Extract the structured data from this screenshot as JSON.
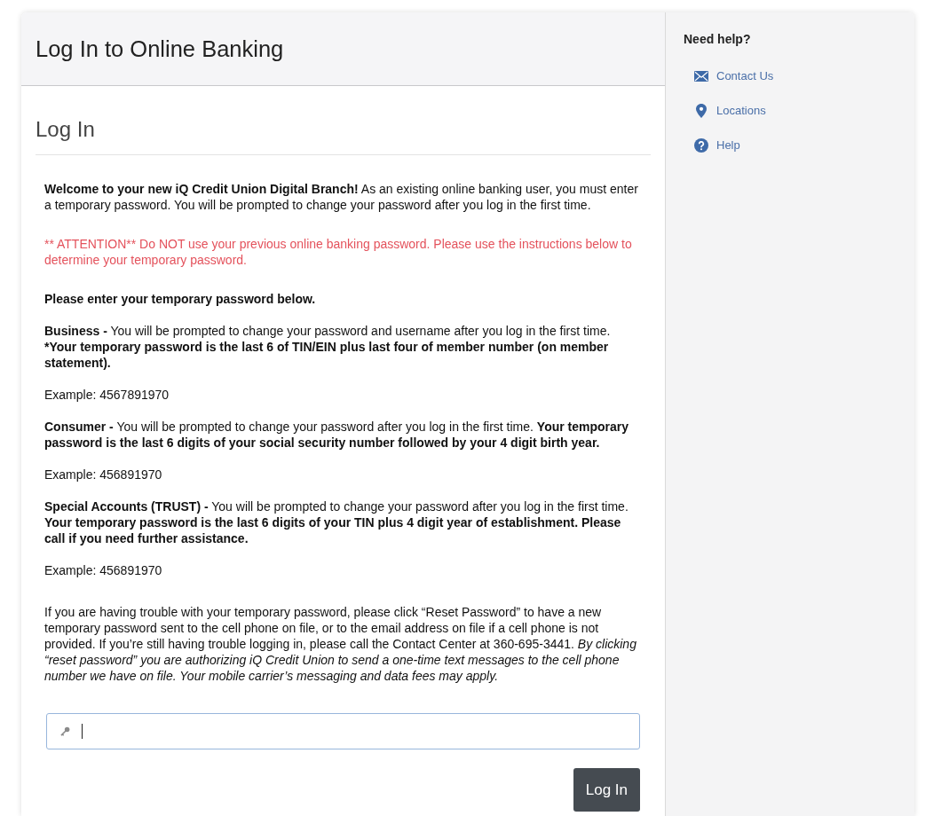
{
  "header": {
    "title": "Log In to Online Banking"
  },
  "login": {
    "title": "Log In",
    "blocks": [
      {
        "paragraphs": [
          {
            "kind": "intro",
            "text": "**Welcome to your new iQ Credit Union Digital Branch!** As an existing online banking user, you must enter a temporary password. You will be prompted to change your password after you log in the first time."
          }
        ]
      },
      {
        "paragraphs": [
          {
            "kind": "alert",
            "text": "** ATTENTION** Do NOT use your previous online banking password. Please use the instructions below to determine your temporary password."
          }
        ]
      },
      {
        "paragraphs": [
          {
            "kind": "lead",
            "text": "Please enter your temporary password below."
          },
          {
            "kind": "account",
            "label": "Business -",
            "text": "You will be prompted to change your password and username after you log in the first time.",
            "note": "*Your temporary password is the last 6 of TIN/EIN plus last four of member number (on member statement)."
          },
          {
            "kind": "example",
            "text": "Example: 4567891970"
          },
          {
            "kind": "account",
            "label": "Consumer -",
            "text": "You will be prompted to change your password after you log in the first time.",
            "note": "Your temporary password is the last 6 digits of your social security number followed by your 4 digit birth year."
          },
          {
            "kind": "example",
            "text": "Example: 456891970"
          },
          {
            "kind": "account",
            "label": "Special Accounts (TRUST) -",
            "text": "You will be prompted to change your password after you log in the first time.",
            "note": "Your temporary password is the last 6 digits of your TIN plus 4 digit year of establishment. Please call if you need further assistance."
          },
          {
            "kind": "example",
            "text": "Example: 456891970"
          }
        ]
      },
      {
        "paragraphs": [
          {
            "kind": "intro",
            "text": "If you are having trouble with your temporary password, please click “Reset Password” to have a new temporary password sent to the cell phone on file, or to the email address on file if a cell phone is not provided. If you’re still having trouble logging in, please call the Contact Center at 360-695-3441. *By clicking “reset password” you are authorizing iQ Credit Union to send a one-time text messages to the cell phone number we have on file. Your mobile carrier’s messaging and data fees may apply.*"
          }
        ]
      }
    ],
    "password": {
      "focused": true
    },
    "button": "Log In"
  },
  "sidebar": {
    "title": "Need help?",
    "links": [
      {
        "label": "Contact Us"
      },
      {
        "label": "Locations"
      },
      {
        "label": "Help"
      }
    ]
  }
}
